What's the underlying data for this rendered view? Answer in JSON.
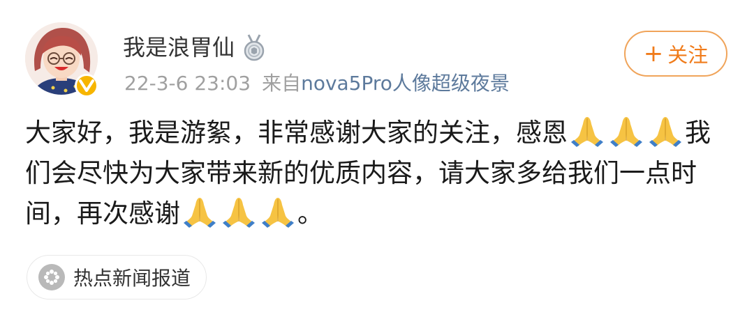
{
  "user": {
    "name": "我是浪胃仙",
    "verified_badge": "V",
    "avatar_icon": "cartoon-woman-avatar",
    "medal_icon": "silver-medal-icon"
  },
  "meta": {
    "timestamp": "22-3-6 23:03",
    "source_prefix": "来自",
    "source_name": "nova5Pro人像超级夜景"
  },
  "follow_button": {
    "plus": "+",
    "label": "关注"
  },
  "content": {
    "segment_1": "大家好，我是游絮，非常感谢大家的关注，感恩",
    "segment_2": "我们会尽快为大家带来新的优质内容，请大家多给我们一点时间，再次感谢",
    "segment_3": "。",
    "emoji": "folded-hands-emoji"
  },
  "topic": {
    "icon": "hot-news-icon",
    "label": "热点新闻报道"
  },
  "colors": {
    "accent_orange": "#f07b1a",
    "follow_border": "#f0a45a",
    "link_blue": "#5d7a9c",
    "meta_gray": "#a0a0a0",
    "badge_yellow": "#f7b500"
  }
}
